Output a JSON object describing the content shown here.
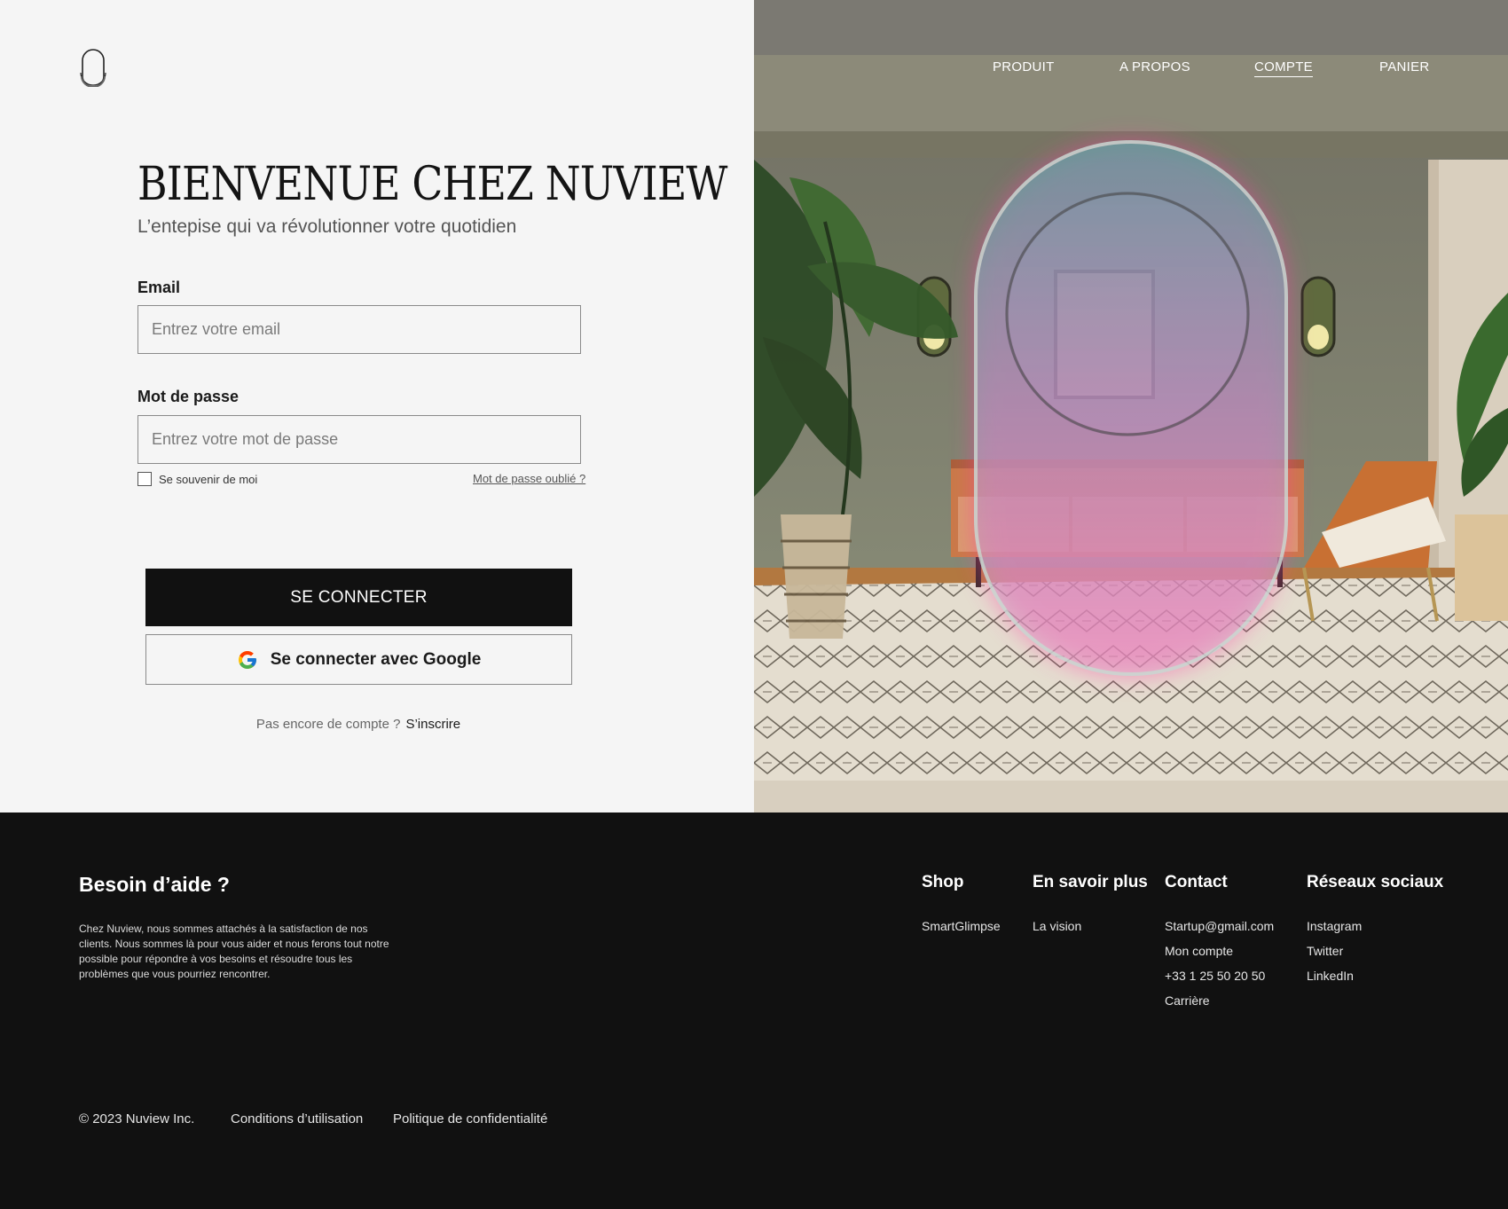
{
  "header": {
    "nav": [
      {
        "label": "PRODUIT",
        "active": false
      },
      {
        "label": "A PROPOS",
        "active": false
      },
      {
        "label": "COMPTE",
        "active": true
      },
      {
        "label": "PANIER",
        "active": false
      }
    ]
  },
  "login": {
    "title": "Bienvenue chez Nuview",
    "subtitle": "L’entepise qui va révolutionner votre quotidien",
    "email_label": "Email",
    "email_placeholder": "Entrez votre email",
    "password_label": "Mot de passe",
    "password_placeholder": "Entrez votre mot de passe",
    "remember_label": "Se souvenir de moi",
    "forgot_label": "Mot de passe oublié ?",
    "submit_label": "SE CONNECTER",
    "google_label": "Se connecter avec Google",
    "no_account_text": "Pas encore de compte ?",
    "signup_label": "S’inscrire"
  },
  "footer": {
    "help_title": "Besoin d’aide ?",
    "help_text": "Chez Nuview, nous sommes attachés à la satisfaction de nos clients. Nous sommes là pour vous aider et nous ferons tout notre possible pour répondre à vos besoins et résoudre tous les problèmes que vous pourriez rencontrer.",
    "columns": [
      {
        "title": "Shop",
        "links": [
          "SmartGlimpse"
        ]
      },
      {
        "title": "En savoir plus",
        "links": [
          "La vision"
        ]
      },
      {
        "title": "Contact",
        "links": [
          "Startup@gmail.com",
          "Mon compte",
          "+33 1 25 50 20 50",
          "Carrière"
        ]
      },
      {
        "title": "Réseaux sociaux",
        "links": [
          "Instagram",
          "Twitter",
          "LinkedIn"
        ]
      }
    ],
    "copyright": "© 2023 Nuview Inc.",
    "terms": "Conditions d’utilisation",
    "privacy": "Politique de confidentialité"
  },
  "colors": {
    "panel_bg": "#f5f5f5",
    "footer_bg": "#111111",
    "primary_button": "#111111",
    "mirror_glow": "#ff3ea5"
  }
}
